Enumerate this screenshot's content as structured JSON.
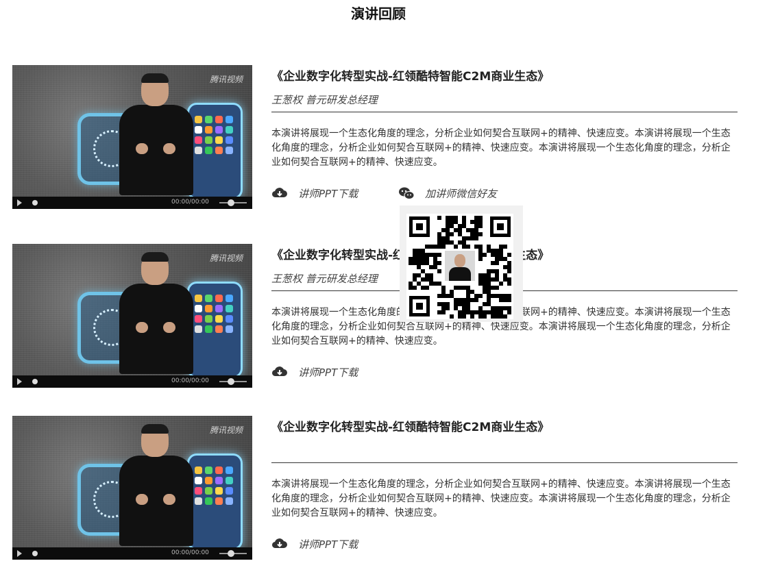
{
  "page": {
    "title": "演讲回顾"
  },
  "video": {
    "time": "00:00/00:00",
    "watermark": "腾讯视频"
  },
  "talks": [
    {
      "title": "《企业数字化转型实战-红领酷特智能C2M商业生态》",
      "speaker": "王葱权 普元研发总经理",
      "description": "本演讲将展现一个生态化角度的理念，分析企业如何契合互联网+的精神、快速应变。本演讲将展现一个生态化角度的理念，分析企业如何契合互联网+的精神、快速应变。本演讲将展现一个生态化角度的理念，分析企业如何契合互联网+的精神、快速应变。",
      "download_label": "讲师PPT下载",
      "wechat_label": "加讲师微信好友"
    },
    {
      "title": "《企业数字化转型实战-红领酷特智能C2M商业生态》",
      "speaker": "王葱权 普元研发总经理",
      "description": "本演讲将展现一个生态化角度的理念，分析企业如何契合互联网+的精神、快速应变。本演讲将展现一个生态化角度的理念，分析企业如何契合互联网+的精神、快速应变。本演讲将展现一个生态化角度的理念，分析企业如何契合互联网+的精神、快速应变。",
      "download_label": "讲师PPT下载"
    },
    {
      "title": "《企业数字化转型实战-红领酷特智能C2M商业生态》",
      "speaker": "",
      "description": "本演讲将展现一个生态化角度的理念，分析企业如何契合互联网+的精神、快速应变。本演讲将展现一个生态化角度的理念，分析企业如何契合互联网+的精神、快速应变。本演讲将展现一个生态化角度的理念，分析企业如何契合互联网+的精神、快速应变。",
      "download_label": "讲师PPT下载"
    }
  ],
  "icons": {
    "download": "cloud-download-icon",
    "wechat": "wechat-icon",
    "play": "play-icon",
    "volume": "volume-icon"
  },
  "colors": {
    "rule": "#333333",
    "text": "#333333",
    "popup_bg": "#f1f1f1"
  }
}
